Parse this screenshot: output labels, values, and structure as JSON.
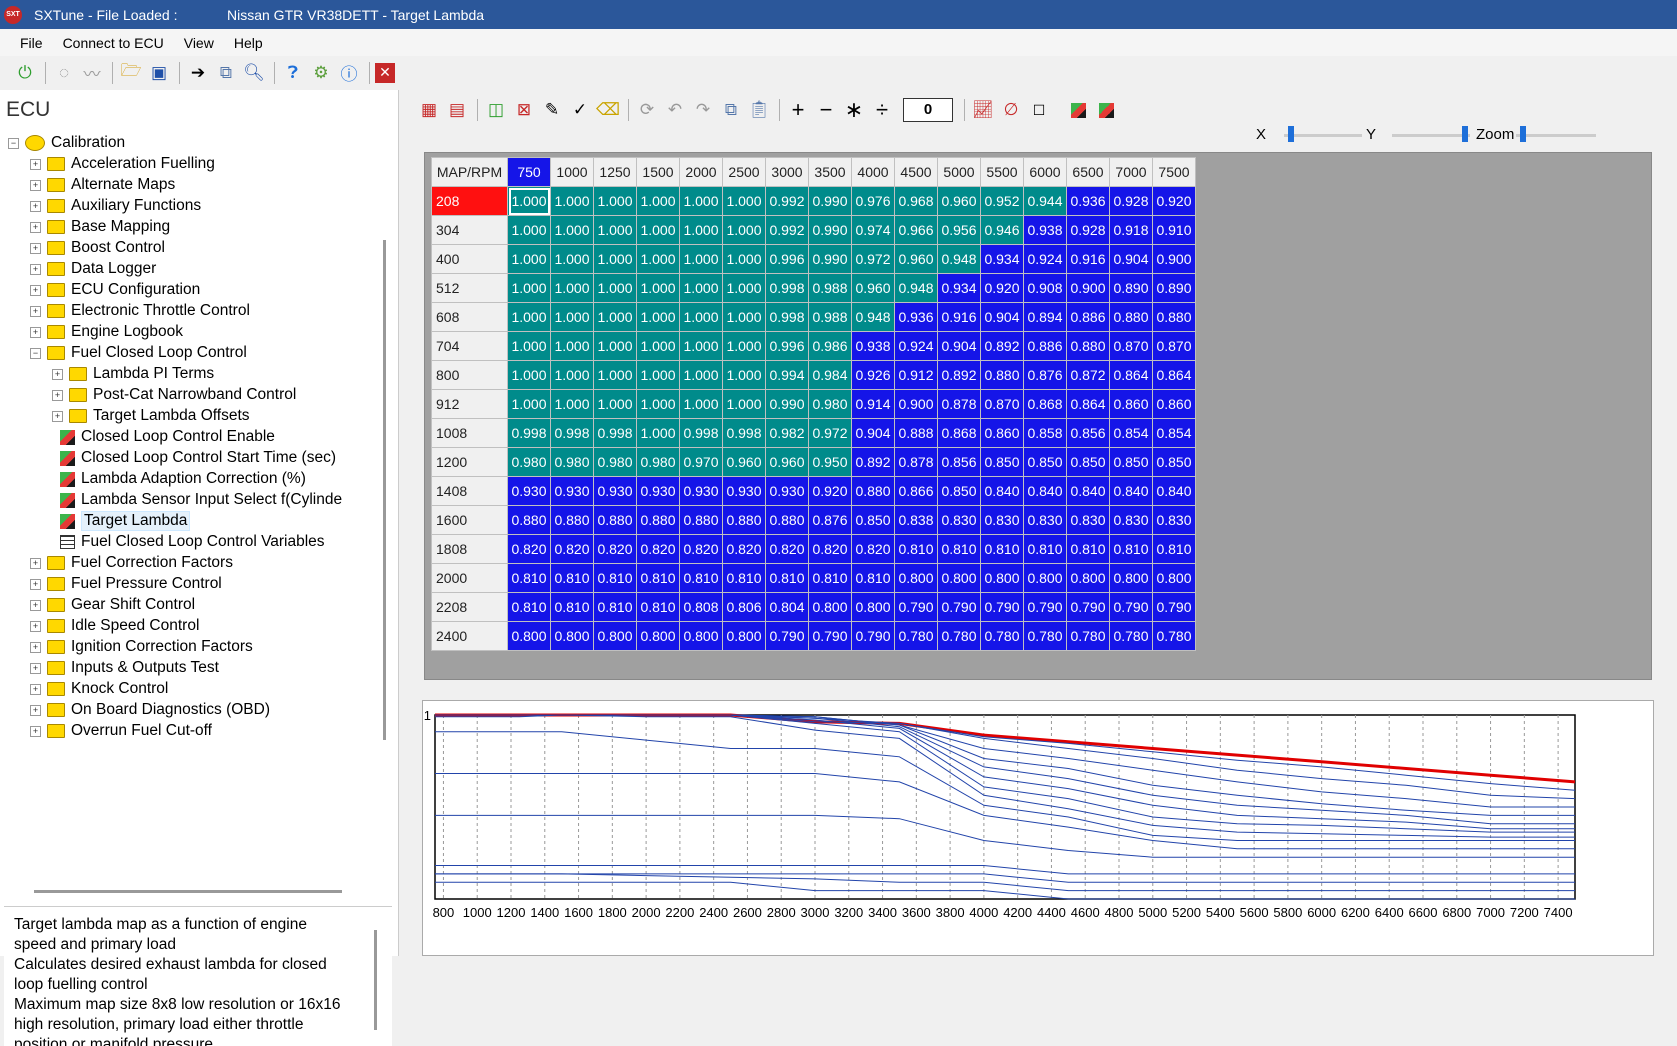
{
  "window": {
    "title_prefix": "SXTune - File Loaded :",
    "title_file": "Nissan GTR VR38DETT - Target Lambda",
    "logo_text": "SXT"
  },
  "menu": [
    "File",
    "Connect to ECU",
    "View",
    "Help"
  ],
  "sidebar": {
    "title": "ECU",
    "root": "Calibration",
    "items": [
      {
        "label": "Acceleration Fuelling",
        "type": "folder",
        "level": 1,
        "expander": "+"
      },
      {
        "label": "Alternate Maps",
        "type": "folder",
        "level": 1,
        "expander": "+"
      },
      {
        "label": "Auxiliary Functions",
        "type": "folder",
        "level": 1,
        "expander": "+"
      },
      {
        "label": "Base Mapping",
        "type": "folder",
        "level": 1,
        "expander": "+"
      },
      {
        "label": "Boost Control",
        "type": "folder",
        "level": 1,
        "expander": "+"
      },
      {
        "label": "Data Logger",
        "type": "folder",
        "level": 1,
        "expander": "+"
      },
      {
        "label": "ECU Configuration",
        "type": "folder",
        "level": 1,
        "expander": "+"
      },
      {
        "label": "Electronic Throttle Control",
        "type": "folder",
        "level": 1,
        "expander": "+"
      },
      {
        "label": "Engine Logbook",
        "type": "folder",
        "level": 1,
        "expander": "+"
      },
      {
        "label": "Fuel Closed Loop Control",
        "type": "folder",
        "level": 1,
        "expander": "-"
      },
      {
        "label": "Lambda PI Terms",
        "type": "folder",
        "level": 2,
        "expander": "+"
      },
      {
        "label": "Post-Cat Narrowband Control",
        "type": "folder",
        "level": 2,
        "expander": "+"
      },
      {
        "label": "Target Lambda Offsets",
        "type": "folder",
        "level": 2,
        "expander": "+"
      },
      {
        "label": "Closed Loop Control Enable",
        "type": "cube",
        "level": 2,
        "expander": ""
      },
      {
        "label": "Closed Loop Control Start Time (sec)",
        "type": "cube",
        "level": 2,
        "expander": ""
      },
      {
        "label": "Lambda Adaption Correction (%)",
        "type": "cube",
        "level": 2,
        "expander": ""
      },
      {
        "label": "Lambda Sensor Input Select f(Cylinde",
        "type": "cube",
        "level": 2,
        "expander": ""
      },
      {
        "label": "Target Lambda",
        "type": "cube",
        "level": 2,
        "expander": "",
        "selected": true
      },
      {
        "label": "Fuel Closed Loop Control Variables",
        "type": "grid",
        "level": 2,
        "expander": ""
      },
      {
        "label": "Fuel Correction Factors",
        "type": "folder",
        "level": 1,
        "expander": "+"
      },
      {
        "label": "Fuel Pressure Control",
        "type": "folder",
        "level": 1,
        "expander": "+"
      },
      {
        "label": "Gear Shift Control",
        "type": "folder",
        "level": 1,
        "expander": "+"
      },
      {
        "label": "Idle Speed Control",
        "type": "folder",
        "level": 1,
        "expander": "+"
      },
      {
        "label": "Ignition Correction Factors",
        "type": "folder",
        "level": 1,
        "expander": "+"
      },
      {
        "label": "Inputs & Outputs Test",
        "type": "folder",
        "level": 1,
        "expander": "+"
      },
      {
        "label": "Knock Control",
        "type": "folder",
        "level": 1,
        "expander": "+"
      },
      {
        "label": "On Board Diagnostics (OBD)",
        "type": "folder",
        "level": 1,
        "expander": "+"
      },
      {
        "label": "Overrun Fuel Cut-off",
        "type": "folder",
        "level": 1,
        "expander": "+"
      }
    ]
  },
  "description": [
    "Target lambda map as a function of engine",
    "speed and primary load",
    "Calculates desired exhaust lambda for closed",
    "loop fuelling control",
    "Maximum map size 8x8 low resolution or 16x16",
    "high resolution, primary load either throttle",
    "position or manifold pressure"
  ],
  "map_toolbar": {
    "value": "0",
    "slider_x": "X",
    "slider_y": "Y",
    "slider_zoom": "Zoom"
  },
  "table": {
    "corner": "MAP/RPM",
    "rpm": [
      "750",
      "1000",
      "1250",
      "1500",
      "2000",
      "2500",
      "3000",
      "3500",
      "4000",
      "4500",
      "5000",
      "5500",
      "6000",
      "6500",
      "7000",
      "7500"
    ],
    "map": [
      "208",
      "304",
      "400",
      "512",
      "608",
      "704",
      "800",
      "912",
      "1008",
      "1200",
      "1408",
      "1600",
      "1808",
      "2000",
      "2208",
      "2400"
    ],
    "values": [
      [
        "1.000",
        "1.000",
        "1.000",
        "1.000",
        "1.000",
        "1.000",
        "0.992",
        "0.990",
        "0.976",
        "0.968",
        "0.960",
        "0.952",
        "0.944",
        "0.936",
        "0.928",
        "0.920"
      ],
      [
        "1.000",
        "1.000",
        "1.000",
        "1.000",
        "1.000",
        "1.000",
        "0.992",
        "0.990",
        "0.974",
        "0.966",
        "0.956",
        "0.946",
        "0.938",
        "0.928",
        "0.918",
        "0.910"
      ],
      [
        "1.000",
        "1.000",
        "1.000",
        "1.000",
        "1.000",
        "1.000",
        "0.996",
        "0.990",
        "0.972",
        "0.960",
        "0.948",
        "0.934",
        "0.924",
        "0.916",
        "0.904",
        "0.900"
      ],
      [
        "1.000",
        "1.000",
        "1.000",
        "1.000",
        "1.000",
        "1.000",
        "0.998",
        "0.988",
        "0.960",
        "0.948",
        "0.934",
        "0.920",
        "0.908",
        "0.900",
        "0.890",
        "0.890"
      ],
      [
        "1.000",
        "1.000",
        "1.000",
        "1.000",
        "1.000",
        "1.000",
        "0.998",
        "0.988",
        "0.948",
        "0.936",
        "0.916",
        "0.904",
        "0.894",
        "0.886",
        "0.880",
        "0.880"
      ],
      [
        "1.000",
        "1.000",
        "1.000",
        "1.000",
        "1.000",
        "1.000",
        "0.996",
        "0.986",
        "0.938",
        "0.924",
        "0.904",
        "0.892",
        "0.886",
        "0.880",
        "0.870",
        "0.870"
      ],
      [
        "1.000",
        "1.000",
        "1.000",
        "1.000",
        "1.000",
        "1.000",
        "0.994",
        "0.984",
        "0.926",
        "0.912",
        "0.892",
        "0.880",
        "0.876",
        "0.872",
        "0.864",
        "0.864"
      ],
      [
        "1.000",
        "1.000",
        "1.000",
        "1.000",
        "1.000",
        "1.000",
        "0.990",
        "0.980",
        "0.914",
        "0.900",
        "0.878",
        "0.870",
        "0.868",
        "0.864",
        "0.860",
        "0.860"
      ],
      [
        "0.998",
        "0.998",
        "0.998",
        "1.000",
        "0.998",
        "0.998",
        "0.982",
        "0.972",
        "0.904",
        "0.888",
        "0.868",
        "0.860",
        "0.858",
        "0.856",
        "0.854",
        "0.854"
      ],
      [
        "0.980",
        "0.980",
        "0.980",
        "0.980",
        "0.970",
        "0.960",
        "0.960",
        "0.950",
        "0.892",
        "0.878",
        "0.856",
        "0.850",
        "0.850",
        "0.850",
        "0.850",
        "0.850"
      ],
      [
        "0.930",
        "0.930",
        "0.930",
        "0.930",
        "0.930",
        "0.930",
        "0.930",
        "0.920",
        "0.880",
        "0.866",
        "0.850",
        "0.840",
        "0.840",
        "0.840",
        "0.840",
        "0.840"
      ],
      [
        "0.880",
        "0.880",
        "0.880",
        "0.880",
        "0.880",
        "0.880",
        "0.880",
        "0.876",
        "0.850",
        "0.838",
        "0.830",
        "0.830",
        "0.830",
        "0.830",
        "0.830",
        "0.830"
      ],
      [
        "0.820",
        "0.820",
        "0.820",
        "0.820",
        "0.820",
        "0.820",
        "0.820",
        "0.820",
        "0.820",
        "0.810",
        "0.810",
        "0.810",
        "0.810",
        "0.810",
        "0.810",
        "0.810"
      ],
      [
        "0.810",
        "0.810",
        "0.810",
        "0.810",
        "0.810",
        "0.810",
        "0.810",
        "0.810",
        "0.810",
        "0.800",
        "0.800",
        "0.800",
        "0.800",
        "0.800",
        "0.800",
        "0.800"
      ],
      [
        "0.810",
        "0.810",
        "0.810",
        "0.810",
        "0.808",
        "0.806",
        "0.804",
        "0.800",
        "0.800",
        "0.790",
        "0.790",
        "0.790",
        "0.790",
        "0.790",
        "0.790",
        "0.790"
      ],
      [
        "0.800",
        "0.800",
        "0.800",
        "0.800",
        "0.800",
        "0.800",
        "0.790",
        "0.790",
        "0.790",
        "0.780",
        "0.780",
        "0.780",
        "0.780",
        "0.780",
        "0.780",
        "0.780"
      ]
    ],
    "colors": {
      "high": "#008b8b",
      "low": "#1515e8",
      "highlight_row_header": "#ff1010",
      "highlight_col_header": "#1515e8"
    }
  },
  "chart_data": {
    "type": "line",
    "y_tick_label": "1",
    "x_ticks": [
      "800",
      "1000",
      "1200",
      "1400",
      "1600",
      "1800",
      "2000",
      "2200",
      "2400",
      "2600",
      "2800",
      "3000",
      "3200",
      "3400",
      "3600",
      "3800",
      "4000",
      "4200",
      "4400",
      "4600",
      "4800",
      "5000",
      "5200",
      "5400",
      "5600",
      "5800",
      "6000",
      "6200",
      "6400",
      "6600",
      "6800",
      "7000",
      "7200",
      "7400"
    ],
    "xlim": [
      750,
      7500
    ],
    "ylim": [
      0.78,
      1.0
    ],
    "highlight_color": "#e00000",
    "line_color": "#2244aa",
    "grid": true
  }
}
